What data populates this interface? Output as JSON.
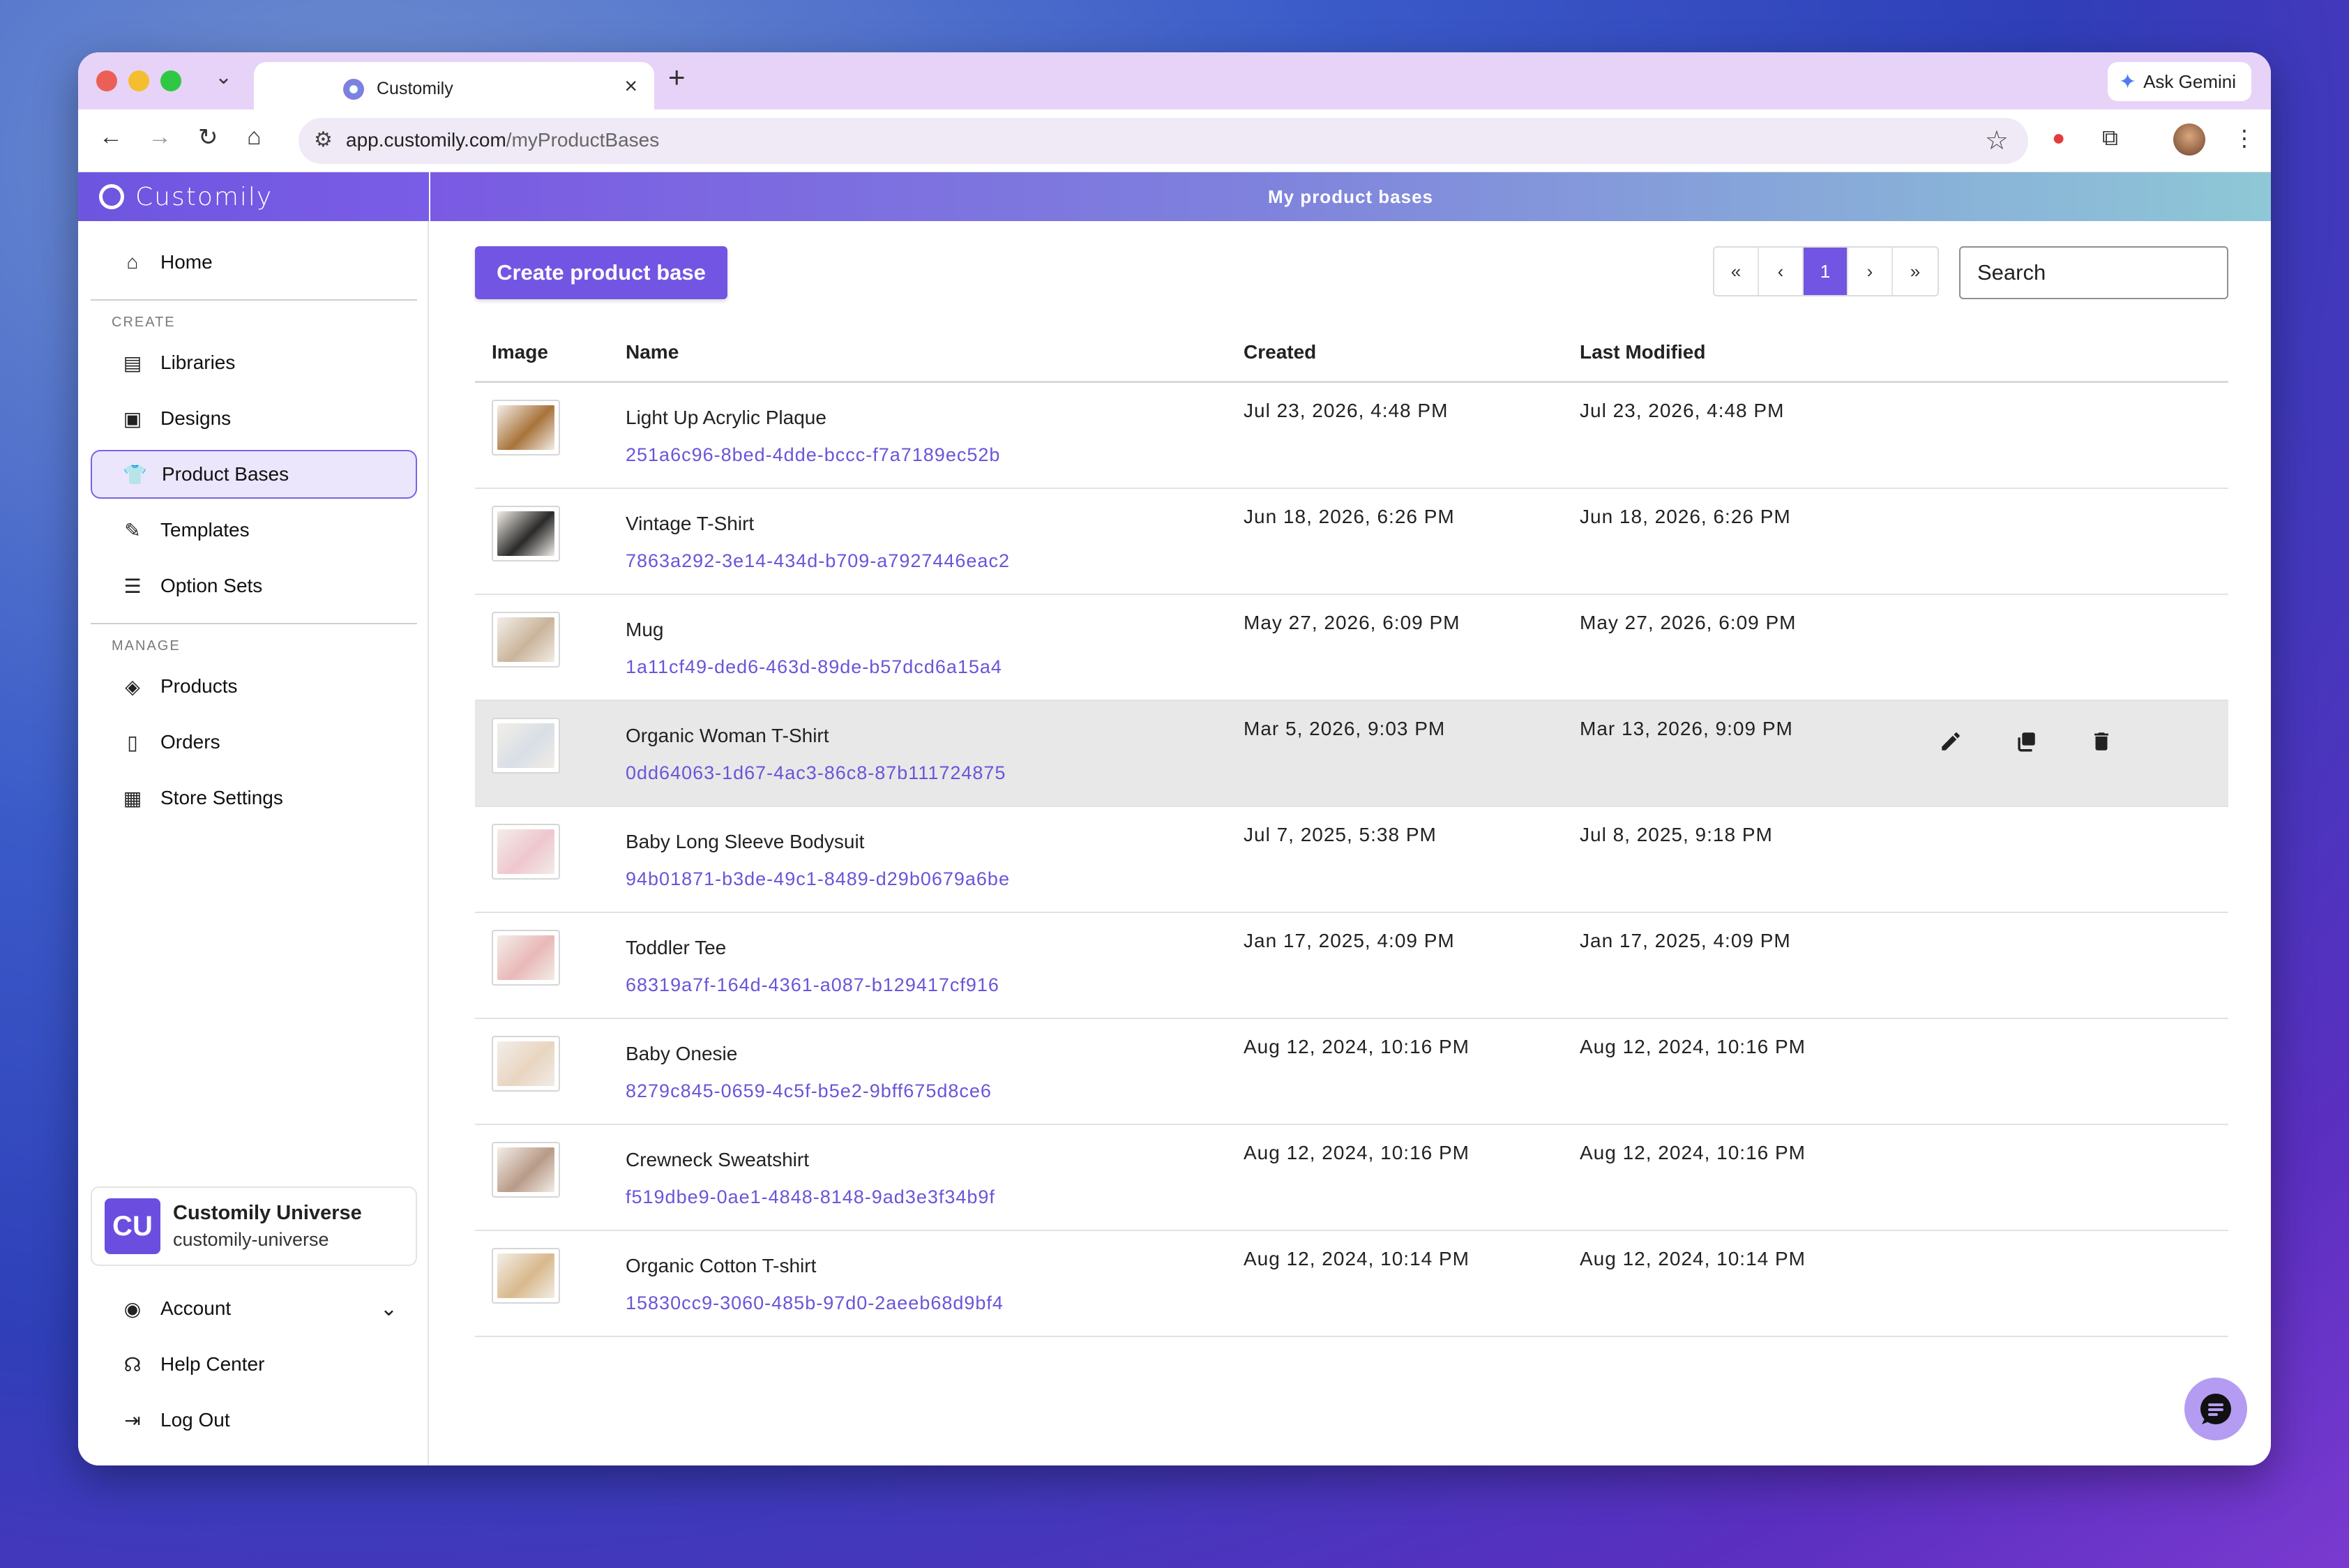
{
  "browser": {
    "tab_title": "Customily",
    "ask_gemini": "Ask Gemini",
    "url_host": "app.customily.com",
    "url_path": "/myProductBases"
  },
  "brand": {
    "name": "Customily",
    "accent": "#7355e3"
  },
  "sidebar": {
    "home": "Home",
    "create_label": "CREATE",
    "create_items": [
      {
        "label": "Libraries",
        "icon": "libraries-icon"
      },
      {
        "label": "Designs",
        "icon": "designs-icon"
      },
      {
        "label": "Product Bases",
        "icon": "tshirt-icon"
      },
      {
        "label": "Templates",
        "icon": "templates-icon"
      },
      {
        "label": "Option Sets",
        "icon": "option-sets-icon"
      }
    ],
    "manage_label": "MANAGE",
    "manage_items": [
      {
        "label": "Products",
        "icon": "tag-icon"
      },
      {
        "label": "Orders",
        "icon": "orders-icon"
      },
      {
        "label": "Store Settings",
        "icon": "store-icon"
      }
    ],
    "org": {
      "initials": "CU",
      "name": "Customily Universe",
      "slug": "customily-universe"
    },
    "account": "Account",
    "help": "Help Center",
    "logout": "Log Out"
  },
  "main": {
    "header_title": "My product bases",
    "create_button": "Create product base",
    "pager": {
      "first": "«",
      "prev": "‹",
      "current": "1",
      "next": "›",
      "last": "»"
    },
    "search_placeholder": "Search",
    "columns": {
      "image": "Image",
      "name": "Name",
      "created": "Created",
      "modified": "Last Modified"
    },
    "rows": [
      {
        "name": "Light Up Acrylic Plaque",
        "id": "251a6c96-8bed-4dde-bccc-f7a7189ec52b",
        "created": "Jul 23, 2026, 4:48 PM",
        "modified": "Jul 23, 2026, 4:48 PM",
        "thumb_color": "#a8733a"
      },
      {
        "name": "Vintage T-Shirt",
        "id": "7863a292-3e14-434d-b709-a7927446eac2",
        "created": "Jun 18, 2026, 6:26 PM",
        "modified": "Jun 18, 2026, 6:26 PM",
        "thumb_color": "#2a2a2a"
      },
      {
        "name": "Mug",
        "id": "1a11cf49-ded6-463d-89de-b57dcd6a15a4",
        "created": "May 27, 2026, 6:09 PM",
        "modified": "May 27, 2026, 6:09 PM",
        "thumb_color": "#c9b49a"
      },
      {
        "name": "Organic Woman T-Shirt",
        "id": "0dd64063-1d67-4ac3-86c8-87b111724875",
        "created": "Mar 5, 2026, 9:03 PM",
        "modified": "Mar 13, 2026, 9:09 PM",
        "thumb_color": "#d8dfe6"
      },
      {
        "name": "Baby Long Sleeve Bodysuit",
        "id": "94b01871-b3de-49c1-8489-d29b0679a6be",
        "created": "Jul 7, 2025, 5:38 PM",
        "modified": "Jul 8, 2025, 9:18 PM",
        "thumb_color": "#efc6cf"
      },
      {
        "name": "Toddler Tee",
        "id": "68319a7f-164d-4361-a087-b129417cf916",
        "created": "Jan 17, 2025, 4:09 PM",
        "modified": "Jan 17, 2025, 4:09 PM",
        "thumb_color": "#e9b8b8"
      },
      {
        "name": "Baby Onesie",
        "id": "8279c845-0659-4c5f-b5e2-9bff675d8ce6",
        "created": "Aug 12, 2024, 10:16 PM",
        "modified": "Aug 12, 2024, 10:16 PM",
        "thumb_color": "#e8d5c0"
      },
      {
        "name": "Crewneck Sweatshirt",
        "id": "f519dbe9-0ae1-4848-8148-9ad3e3f34b9f",
        "created": "Aug 12, 2024, 10:16 PM",
        "modified": "Aug 12, 2024, 10:16 PM",
        "thumb_color": "#b89a88"
      },
      {
        "name": "Organic Cotton T-shirt",
        "id": "15830cc9-3060-485b-97d0-2aeeb68d9bf4",
        "created": "Aug 12, 2024, 10:14 PM",
        "modified": "Aug 12, 2024, 10:14 PM",
        "thumb_color": "#d9b98c"
      }
    ],
    "row_actions": [
      "edit-icon",
      "duplicate-icon",
      "delete-icon"
    ]
  }
}
